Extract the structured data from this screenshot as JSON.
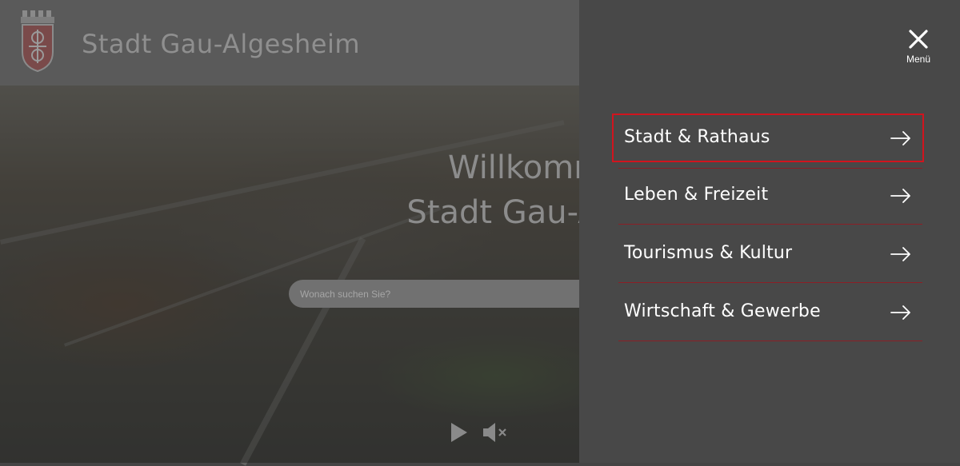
{
  "header": {
    "site_title": "Stadt Gau-Algesheim",
    "logo_icon": "coat-of-arms-icon"
  },
  "hero": {
    "title_line1": "Willkommen bei",
    "title_line2": "Stadt Gau-Algesheim",
    "search_placeholder": "Wonach suchen Sie?"
  },
  "video_controls": {
    "play_icon": "play-icon",
    "mute_icon": "mute-icon"
  },
  "menu": {
    "close_label": "Menü",
    "items": [
      {
        "label": "Stadt & Rathaus",
        "active": true
      },
      {
        "label": "Leben & Freizeit",
        "active": false
      },
      {
        "label": "Tourismus & Kultur",
        "active": false
      },
      {
        "label": "Wirtschaft & Gewerbe",
        "active": false
      }
    ]
  },
  "colors": {
    "menu_background": "#484848",
    "divider": "#8b1f26",
    "highlight": "#d1141e"
  }
}
